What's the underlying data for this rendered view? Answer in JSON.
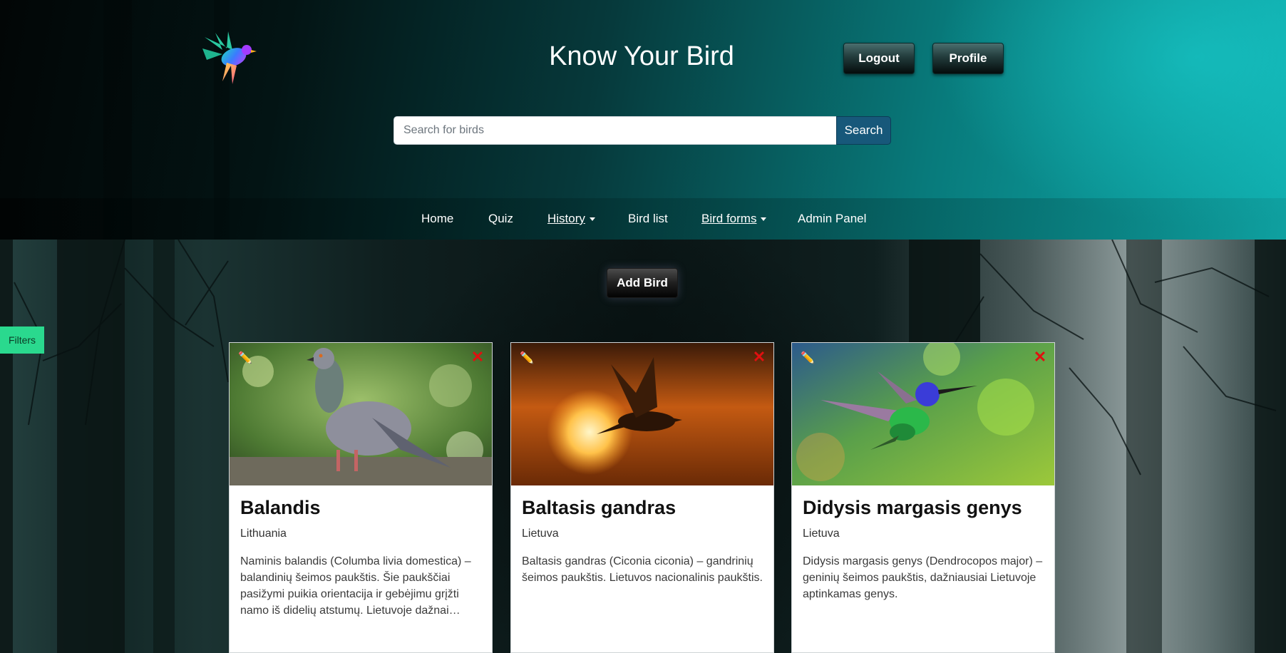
{
  "header": {
    "title": "Know Your Bird",
    "logout_label": "Logout",
    "profile_label": "Profile"
  },
  "search": {
    "placeholder": "Search for birds",
    "value": "",
    "button_label": "Search"
  },
  "nav": {
    "items": [
      {
        "label": "Home",
        "dropdown": false
      },
      {
        "label": "Quiz",
        "dropdown": false
      },
      {
        "label": "History",
        "dropdown": true
      },
      {
        "label": "Bird list",
        "dropdown": false
      },
      {
        "label": "Bird forms",
        "dropdown": true
      },
      {
        "label": "Admin Panel",
        "dropdown": false
      }
    ]
  },
  "add_bird_label": "Add Bird",
  "filters_label": "Filters",
  "icons": {
    "logo": "colorful-bird-logo",
    "edit": "pencil-icon",
    "delete": "close-x-icon",
    "caret": "caret-down-icon"
  },
  "colors": {
    "header_teal": "#10aeae",
    "search_button": "#17587a",
    "filters_tab": "#2ad98e",
    "delete_icon": "#e01010",
    "edit_icon": "#f2c200"
  },
  "cards": [
    {
      "title": "Balandis",
      "country": "Lithuania",
      "description": "Naminis balandis (Columba livia domestica) – balandinių šeimos paukštis. Šie paukščiai pasižymi puikia orientacija ir gebėjimu grįžti namo iš didelių atstumų. Lietuvoje dažnai…",
      "image": "pigeon-photo"
    },
    {
      "title": "Baltasis gandras",
      "country": "Lietuva",
      "description": "Baltasis gandras (Ciconia ciconia) – gandrinių šeimos paukštis. Lietuvos nacionalinis paukštis.",
      "image": "bird-silhouette-sunset-photo"
    },
    {
      "title": "Didysis margasis genys",
      "country": "Lietuva",
      "description": "Didysis margasis genys (Dendrocopos major) – geninių šeimos paukštis, dažniausiai Lietuvoje aptinkamas genys.",
      "image": "hummingbird-photo"
    }
  ]
}
